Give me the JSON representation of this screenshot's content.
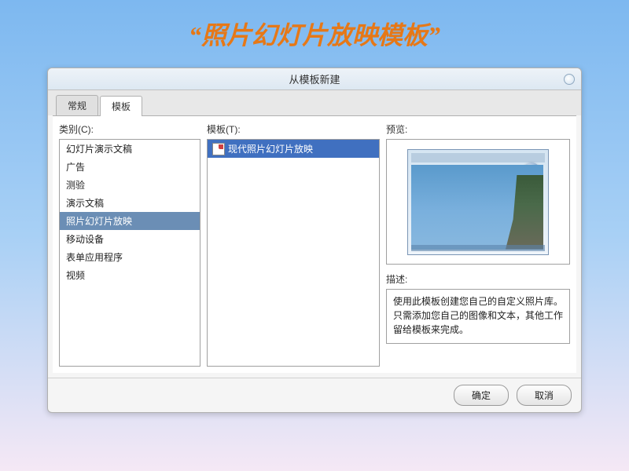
{
  "page_title": "“照片幻灯片放映模板”",
  "dialog": {
    "title": "从模板新建",
    "tabs": [
      {
        "label": "常规",
        "active": false
      },
      {
        "label": "模板",
        "active": true
      }
    ],
    "category_label": "类别(C):",
    "categories": [
      {
        "label": "幻灯片演示文稿",
        "selected": false
      },
      {
        "label": "广告",
        "selected": false
      },
      {
        "label": "测验",
        "selected": false
      },
      {
        "label": "演示文稿",
        "selected": false
      },
      {
        "label": "照片幻灯片放映",
        "selected": true
      },
      {
        "label": "移动设备",
        "selected": false
      },
      {
        "label": "表单应用程序",
        "selected": false
      },
      {
        "label": "视频",
        "selected": false
      }
    ],
    "template_label": "模板(T):",
    "templates": [
      {
        "label": "现代照片幻灯片放映",
        "selected": true
      }
    ],
    "preview_label": "预览:",
    "description_label": "描述:",
    "description_text": "使用此模板创建您自己的自定义照片库。只需添加您自己的图像和文本，其他工作留给模板来完成。",
    "buttons": {
      "ok": "确定",
      "cancel": "取消"
    }
  }
}
